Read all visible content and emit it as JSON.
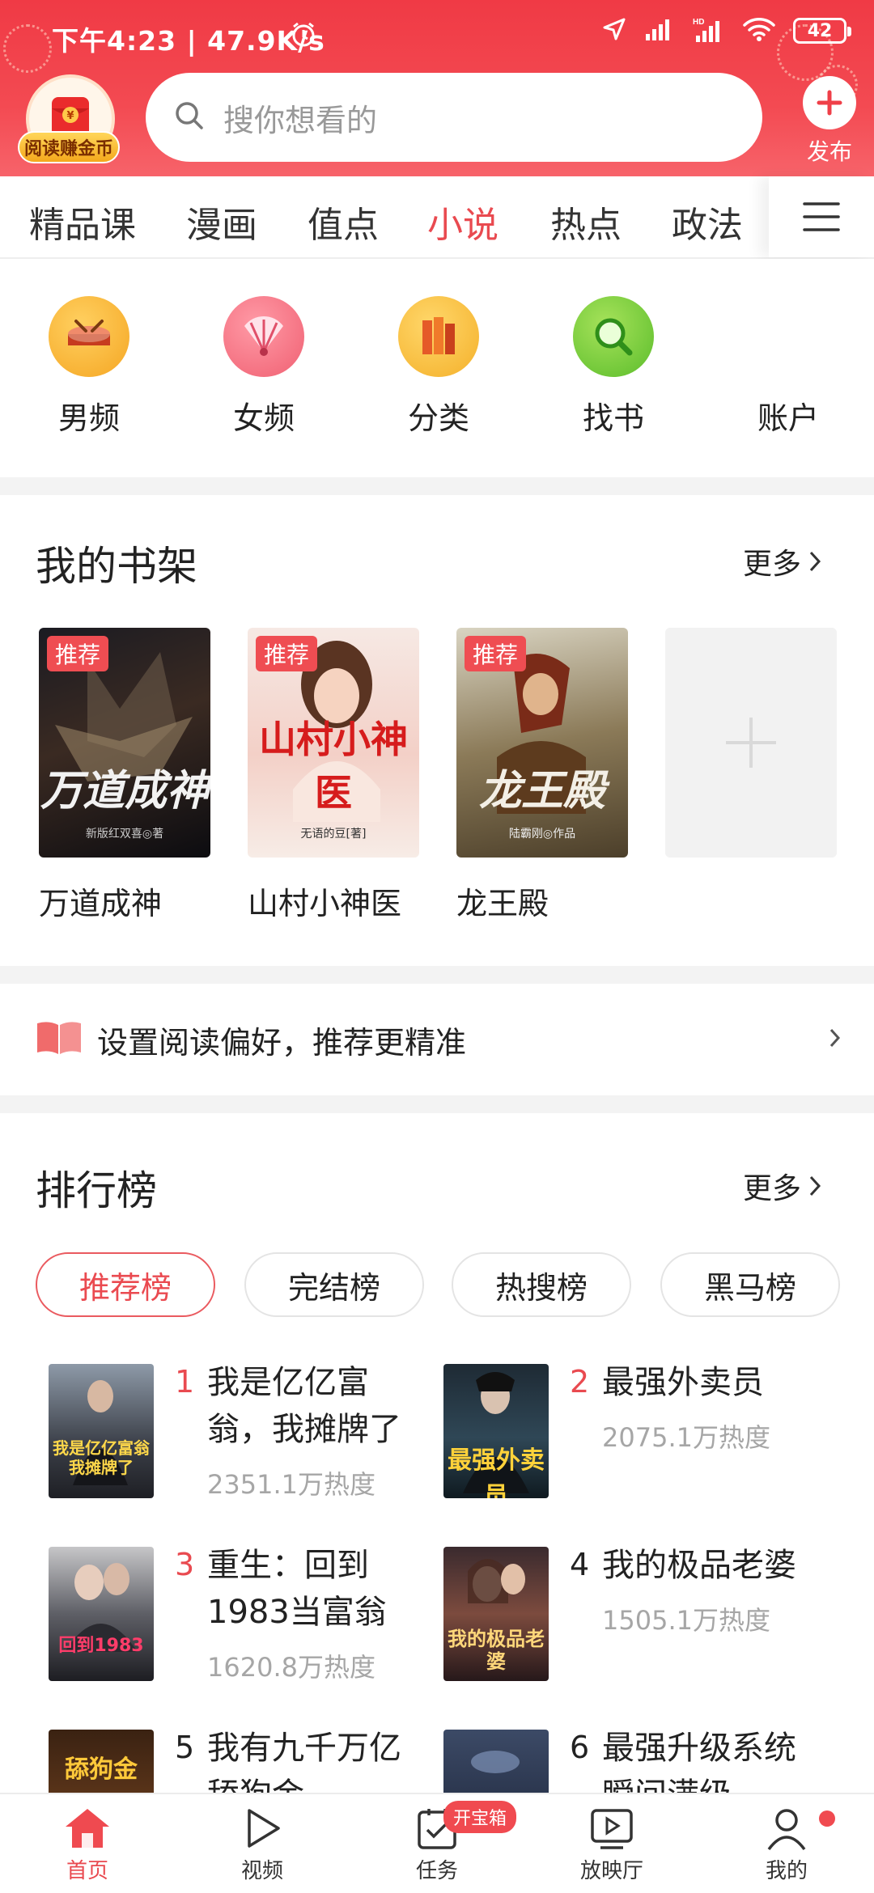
{
  "status_bar": {
    "time_speed": "下午4:23 | 47.9K/s",
    "battery": "42"
  },
  "header": {
    "coin_badge": "阅读赚金币",
    "search_placeholder": "搜你想看的",
    "publish_label": "发布"
  },
  "tabs": [
    "精品课",
    "漫画",
    "值点",
    "小说",
    "热点",
    "政法"
  ],
  "active_tab": "小说",
  "quick_entries": [
    {
      "label": "男频",
      "icon": "drum-icon"
    },
    {
      "label": "女频",
      "icon": "fan-icon"
    },
    {
      "label": "分类",
      "icon": "books-icon"
    },
    {
      "label": "找书",
      "icon": "magnifier-icon"
    },
    {
      "label": "账户",
      "icon": "account-icon"
    }
  ],
  "shelf": {
    "title": "我的书架",
    "more": "更多",
    "tag": "推荐",
    "books": [
      {
        "name": "万道成神",
        "cover_title": "万道成神",
        "cover_author": "新版红双喜◎著"
      },
      {
        "name": "山村小神医",
        "cover_title": "山村小神医",
        "cover_author": "无语的豆[著]"
      },
      {
        "name": "龙王殿",
        "cover_title": "龙王殿",
        "cover_author": "陆霸刚◎作品"
      }
    ]
  },
  "preference": {
    "text": "设置阅读偏好，推荐更精准"
  },
  "ranking": {
    "title": "排行榜",
    "more": "更多",
    "chips": [
      "推荐榜",
      "完结榜",
      "热搜榜",
      "黑马榜"
    ],
    "items": [
      {
        "rank": "1",
        "title": "我是亿亿富翁，我摊牌了",
        "heat": "2351.1万热度",
        "cover_text": "我是亿亿富翁 我摊牌了"
      },
      {
        "rank": "2",
        "title": "最强外卖员",
        "heat": "2075.1万热度",
        "cover_text": "最强外卖员"
      },
      {
        "rank": "3",
        "title": "重生：回到1983当富翁",
        "heat": "1620.8万热度",
        "cover_text": "回到1983"
      },
      {
        "rank": "4",
        "title": "我的极品老婆",
        "heat": "1505.1万热度",
        "cover_text": "我的极品老婆"
      },
      {
        "rank": "5",
        "title": "我有九千万亿舔狗金",
        "heat": "",
        "cover_text": "舔狗金"
      },
      {
        "rank": "6",
        "title": "最强升级系统瞬间满级",
        "heat": "",
        "cover_text": ""
      }
    ]
  },
  "bottom_nav": [
    {
      "label": "首页"
    },
    {
      "label": "视频"
    },
    {
      "label": "任务"
    },
    {
      "label": "放映厅"
    },
    {
      "label": "我的"
    }
  ],
  "task_badge": "开宝箱",
  "colors": {
    "brand_red": "#f03a45",
    "active_red": "#e94a50",
    "rank_top3": "#e94a50",
    "heat_gray": "#a6a6a6"
  }
}
